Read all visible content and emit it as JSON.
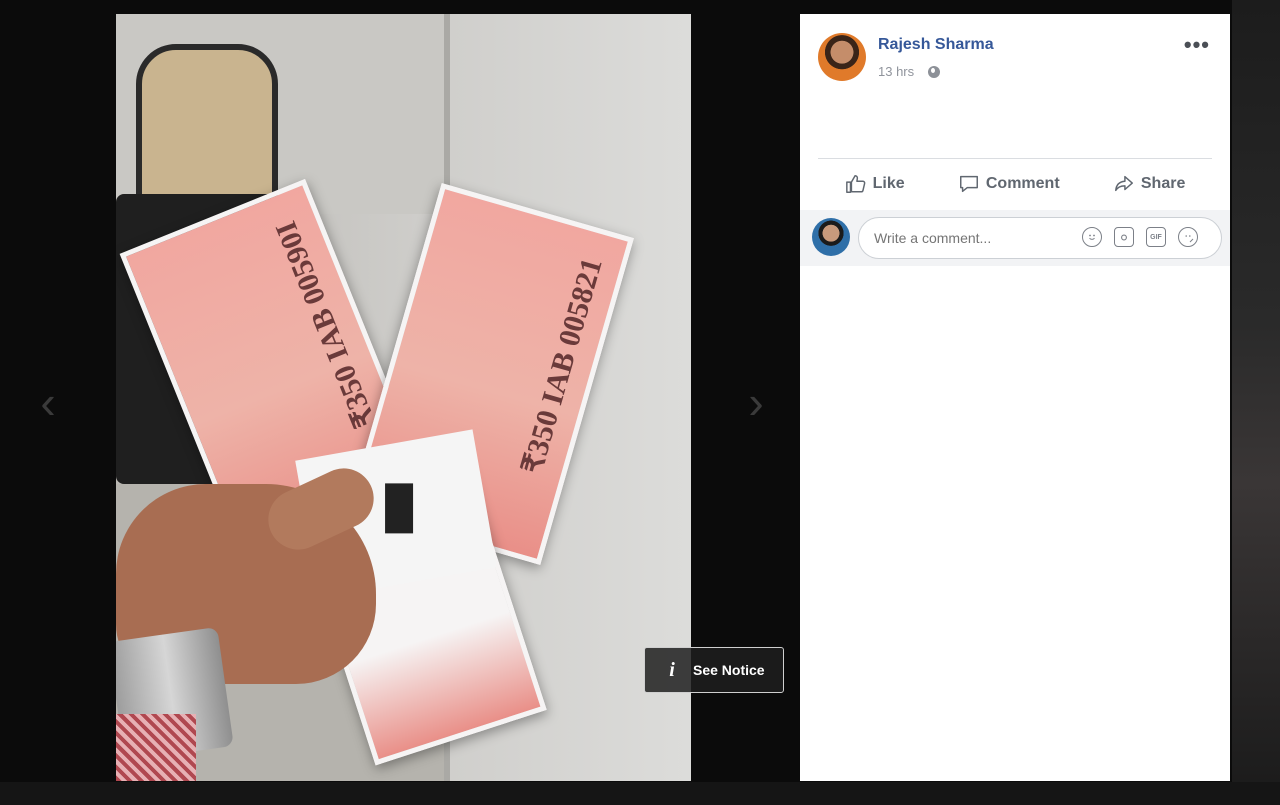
{
  "post": {
    "author": "Rajesh Sharma",
    "time": "13 hrs",
    "privacy_icon": "globe-icon"
  },
  "actions": {
    "like": "Like",
    "comment": "Comment",
    "share": "Share"
  },
  "comment_box": {
    "placeholder": "Write a comment...",
    "tools": [
      "emoji-icon",
      "camera-icon",
      "gif-icon",
      "sticker-icon"
    ],
    "gif_label": "GIF"
  },
  "photo": {
    "note_serial_a": "₹350 IAB 00590I",
    "note_serial_b": "₹350 IAB 005821"
  },
  "notice": {
    "label": "See Notice",
    "icon": "i"
  },
  "nav": {
    "prev": "‹",
    "next": "›",
    "more": "•••"
  }
}
